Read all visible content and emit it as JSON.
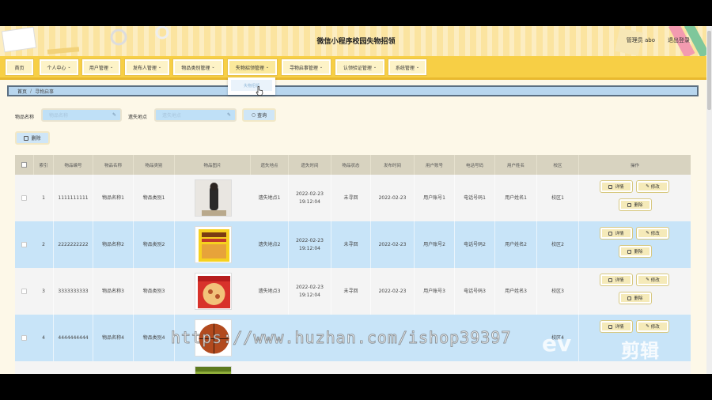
{
  "header": {
    "title": "微信小程序校园失物招领",
    "admin": "管理员 abo",
    "logout": "退出登录"
  },
  "nav": {
    "items": [
      {
        "label": "首页",
        "dropdown": false
      },
      {
        "label": "个人中心",
        "dropdown": true
      },
      {
        "label": "用户管理",
        "dropdown": true
      },
      {
        "label": "发布人管理",
        "dropdown": true
      },
      {
        "label": "物品类别管理",
        "dropdown": true
      },
      {
        "label": "失物招领管理",
        "dropdown": true
      },
      {
        "label": "寻物启事管理",
        "dropdown": true
      },
      {
        "label": "认领验证管理",
        "dropdown": true
      },
      {
        "label": "系统管理",
        "dropdown": true
      }
    ],
    "dropdown_item": "失物招领"
  },
  "breadcrumb": {
    "home": "首页",
    "separator": "/",
    "current": "寻物启事"
  },
  "search": {
    "name_label": "物品名称",
    "name_placeholder": "物品名称",
    "place_label": "遗失地点",
    "place_placeholder": "遗失地点",
    "button": "查询",
    "delete_button": "删除"
  },
  "table": {
    "headers": [
      "索引",
      "物品编号",
      "物品名称",
      "物品类别",
      "物品图片",
      "遗失地点",
      "遗失时间",
      "物品状态",
      "发布时间",
      "用户账号",
      "电话号码",
      "用户姓名",
      "校区",
      "操作"
    ],
    "rows": [
      {
        "index": "1",
        "code": "1111111111",
        "name": "物品名称1",
        "category": "物品类别1",
        "place": "遗失地点1",
        "lost_date": "2022-02-23",
        "lost_time": "19:12:04",
        "status": "未寻回",
        "publish": "2022-02-23",
        "account": "用户账号1",
        "phone": "电话号码1",
        "user": "用户姓名1",
        "campus": "校区1"
      },
      {
        "index": "2",
        "code": "2222222222",
        "name": "物品名称2",
        "category": "物品类别2",
        "place": "遗失地点2",
        "lost_date": "2022-02-23",
        "lost_time": "19:12:04",
        "status": "未寻回",
        "publish": "2022-02-23",
        "account": "用户账号2",
        "phone": "电话号码2",
        "user": "用户姓名2",
        "campus": "校区2"
      },
      {
        "index": "3",
        "code": "3333333333",
        "name": "物品名称3",
        "category": "物品类别3",
        "place": "遗失地点3",
        "lost_date": "2022-02-23",
        "lost_time": "19:12:04",
        "status": "未寻回",
        "publish": "2022-02-23",
        "account": "用户账号3",
        "phone": "电话号码3",
        "user": "用户姓名3",
        "campus": "校区3"
      },
      {
        "index": "4",
        "code": "4444444444",
        "name": "物品名称4",
        "category": "物品类别4",
        "place": "",
        "lost_date": "",
        "lost_time": "",
        "status": "",
        "publish": "",
        "account": "",
        "phone": "",
        "user": "",
        "campus": "校区4"
      }
    ],
    "actions": {
      "detail": "详情",
      "edit": "修改",
      "delete": "删除"
    }
  },
  "overlay": {
    "watermark": "https://www.huzhan.com/ishop39397",
    "logo_left": "ev",
    "logo_right": "剪辑"
  },
  "colors": {
    "nav_bg": "#f7cf45",
    "header_bg": "#fbe4a0",
    "row_highlight": "#c8e4f8",
    "breadcrumb_bg": "#b8d6ee"
  }
}
